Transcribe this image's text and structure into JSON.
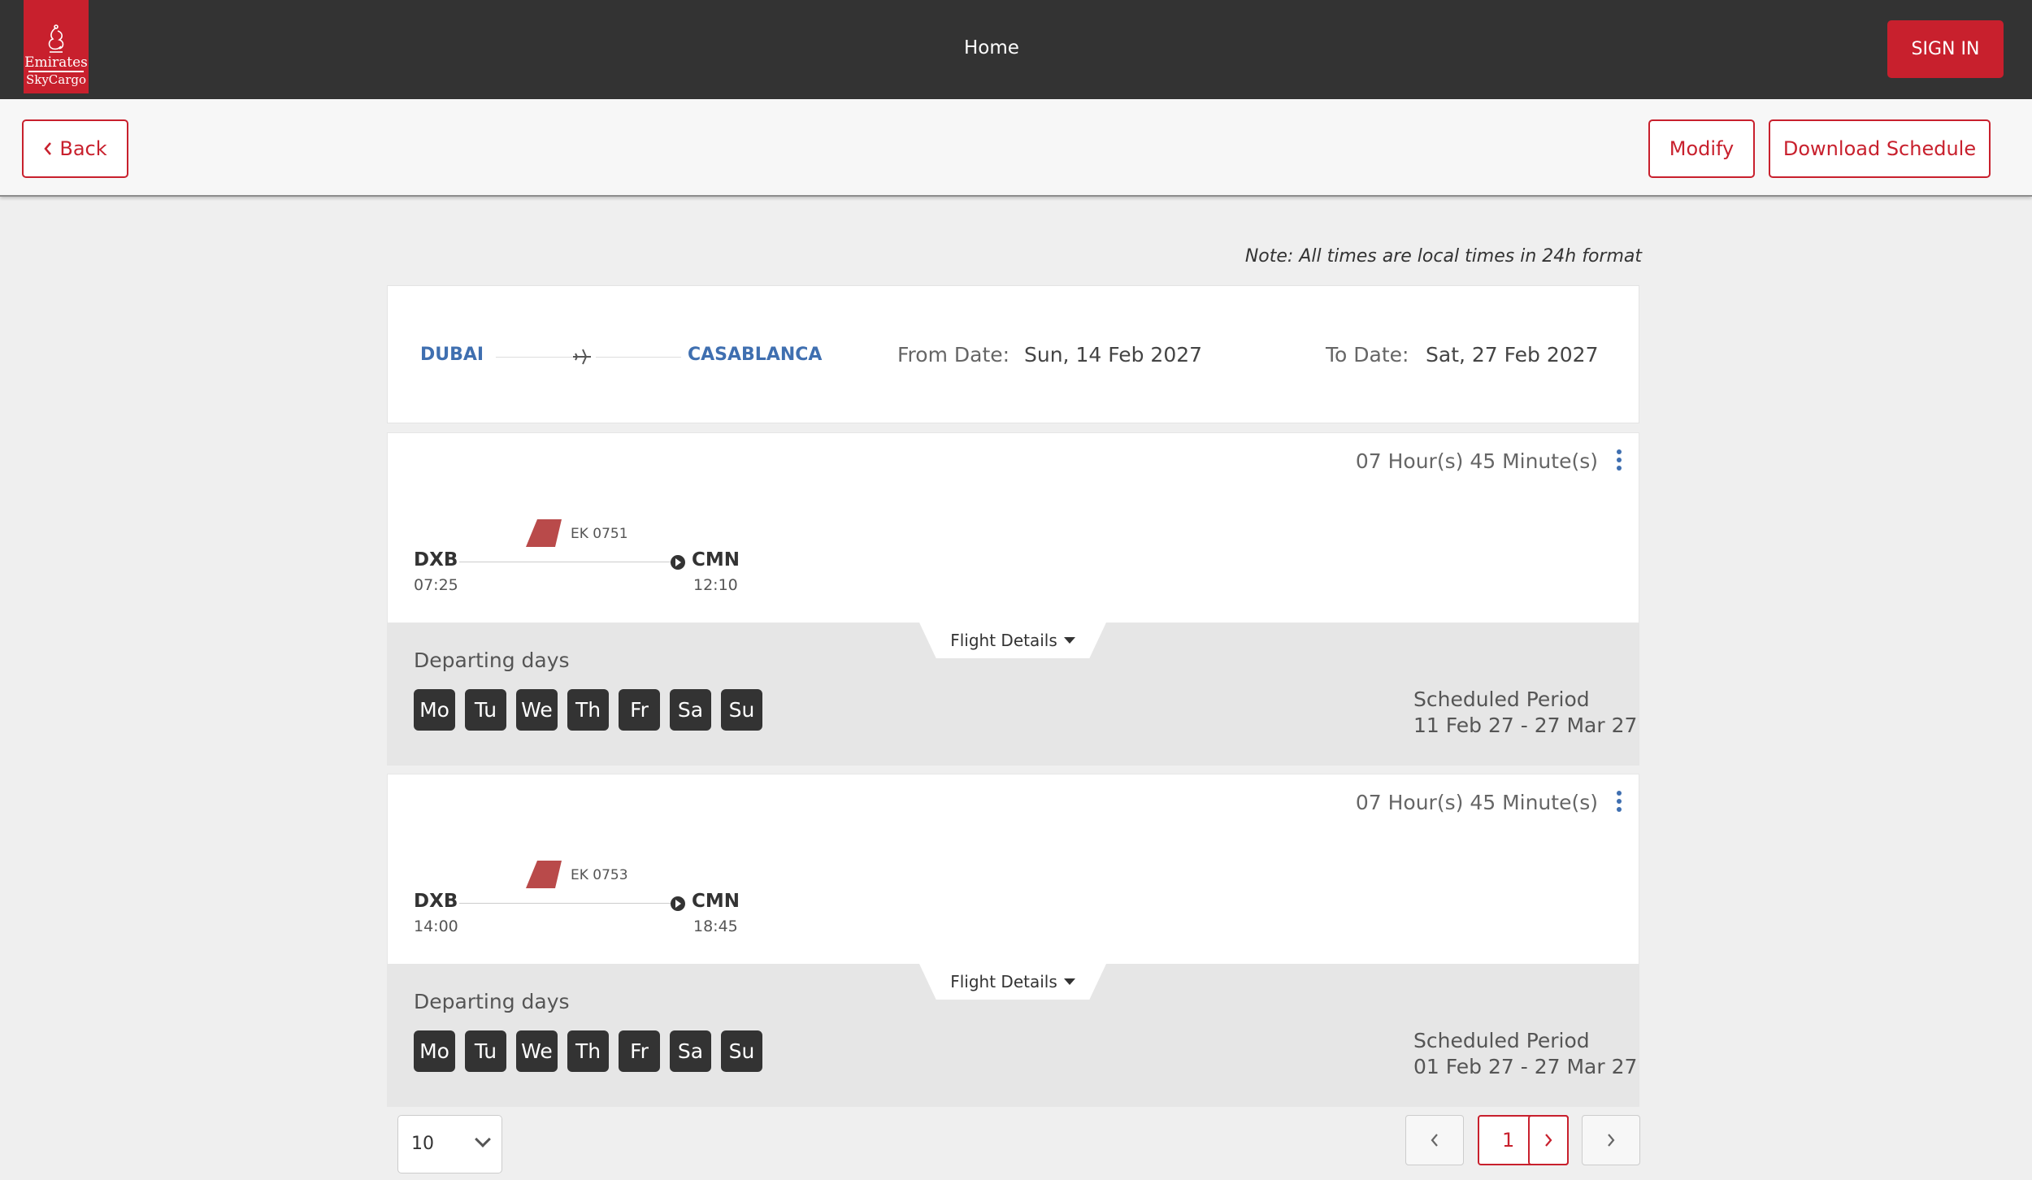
{
  "header": {
    "logo": {
      "line1": "Emirates",
      "line2": "SkyCargo"
    },
    "home_label": "Home",
    "sign_in_label": "SIGN IN"
  },
  "toolbar": {
    "back_label": "Back",
    "modify_label": "Modify",
    "download_label": "Download Schedule"
  },
  "note": "Note: All times are local times in 24h format",
  "route": {
    "origin": "DUBAI",
    "destination": "CASABLANCA",
    "from_label": "From Date:",
    "from_value": "Sun, 14 Feb 2027",
    "to_label": "To Date:",
    "to_value": "Sat, 27 Feb 2027"
  },
  "flights": [
    {
      "duration": "07 Hour(s) 45 Minute(s)",
      "flight_no": "EK 0751",
      "origin_code": "DXB",
      "origin_time": "07:25",
      "dest_code": "CMN",
      "dest_time": "12:10",
      "details_label": "Flight Details",
      "departing_label": "Departing days",
      "days": [
        "Mo",
        "Tu",
        "We",
        "Th",
        "Fr",
        "Sa",
        "Su"
      ],
      "scheduled_label": "Scheduled Period",
      "scheduled_value": "11 Feb 27 - 27 Mar 27"
    },
    {
      "duration": "07 Hour(s) 45 Minute(s)",
      "flight_no": "EK 0753",
      "origin_code": "DXB",
      "origin_time": "14:00",
      "dest_code": "CMN",
      "dest_time": "18:45",
      "details_label": "Flight Details",
      "departing_label": "Departing days",
      "days": [
        "Mo",
        "Tu",
        "We",
        "Th",
        "Fr",
        "Sa",
        "Su"
      ],
      "scheduled_label": "Scheduled Period",
      "scheduled_value": "01 Feb 27 - 27 Mar 27"
    }
  ],
  "pagination": {
    "page_size": "10",
    "current_page": "1",
    "prev_icon": "chevron-left-icon",
    "next_icon": "chevron-right-icon"
  },
  "colors": {
    "brand_red": "#c8202d",
    "header_bg": "#333333",
    "link_blue": "#3f6fb0",
    "day_chip": "#333333"
  }
}
